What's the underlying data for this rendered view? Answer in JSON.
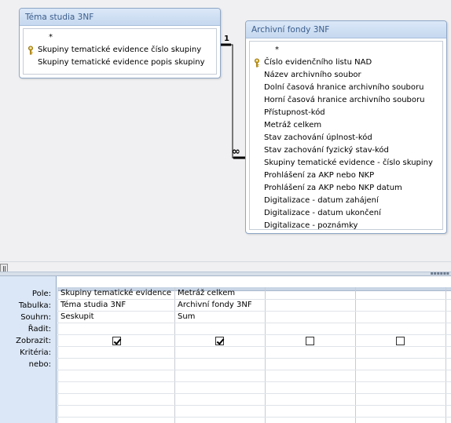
{
  "tables": [
    {
      "title": "Téma studia 3NF",
      "fields": [
        {
          "label": "*",
          "key": false
        },
        {
          "label": "Skupiny tematické evidence číslo skupiny",
          "key": true
        },
        {
          "label": "Skupiny tematické evidence popis skupiny",
          "key": false
        }
      ]
    },
    {
      "title": "Archivní fondy 3NF",
      "fields": [
        {
          "label": "*",
          "key": false
        },
        {
          "label": "Číslo evidenčního listu NAD",
          "key": true
        },
        {
          "label": "Název archivního soubor",
          "key": false
        },
        {
          "label": "Dolní časová hranice archivního souboru",
          "key": false
        },
        {
          "label": "Horní časová hranice archivního souboru",
          "key": false
        },
        {
          "label": "Přístupnost-kód",
          "key": false
        },
        {
          "label": "Metráž celkem",
          "key": false
        },
        {
          "label": "Stav zachování úplnost-kód",
          "key": false
        },
        {
          "label": "Stav zachování  fyzický stav-kód",
          "key": false
        },
        {
          "label": "Skupiny tematické evidence - číslo skupiny",
          "key": false
        },
        {
          "label": "Prohlášení za AKP nebo NKP",
          "key": false
        },
        {
          "label": "Prohlášení za AKP nebo NKP datum",
          "key": false
        },
        {
          "label": "Digitalizace - datum zahájení",
          "key": false
        },
        {
          "label": "Digitalizace - datum ukončení",
          "key": false
        },
        {
          "label": "Digitalizace - poznámky",
          "key": false
        }
      ]
    }
  ],
  "relationship": {
    "one_symbol": "1",
    "many_symbol": "∞"
  },
  "grid": {
    "row_labels": {
      "field": "Pole:",
      "table": "Tabulka:",
      "total": "Souhrn:",
      "sort": "Řadit:",
      "show": "Zobrazit:",
      "criteria": "Kritéria:",
      "or": "nebo:"
    },
    "columns": [
      {
        "field": "Skupiny tematické evidence",
        "table": "Téma studia 3NF",
        "total": "Seskupit",
        "show": true
      },
      {
        "field": "Metráž celkem",
        "table": "Archivní fondy 3NF",
        "total": "Sum",
        "show": true
      },
      {
        "field": "",
        "table": "",
        "total": "",
        "show": false
      },
      {
        "field": "",
        "table": "",
        "total": "",
        "show": false
      }
    ]
  },
  "colors": {
    "title_text": "#3a5d8c",
    "grid_label_bg": "#dbe7f6",
    "line": "#000000"
  }
}
